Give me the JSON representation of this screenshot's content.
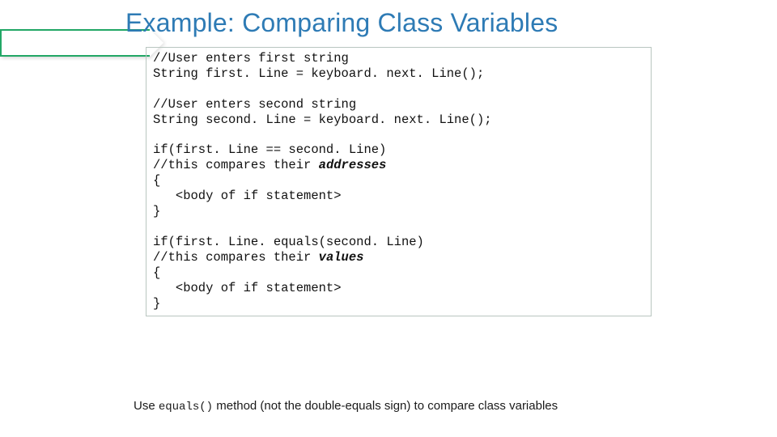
{
  "title": "Example: Comparing Class Variables",
  "code": {
    "l1": "//User enters first string",
    "l2": "String first. Line = keyboard. next. Line();",
    "blank1": "",
    "l3": "//User enters second string",
    "l4": "String second. Line = keyboard. next. Line();",
    "blank2": "",
    "l5": "if(first. Line == second. Line)",
    "l6a": "//this compares their ",
    "l6b": "addresses",
    "l7": "{",
    "l8": "   <body of if statement>",
    "l9": "}",
    "blank3": "",
    "l10": "if(first. Line. equals(second. Line)",
    "l11a": "//this compares their ",
    "l11b": "values",
    "l12": "{",
    "l13": "   <body of if statement>",
    "l14": "}"
  },
  "caption": {
    "pre": "Use ",
    "mono": "equals()",
    "post": " method (not the double-equals sign) to compare class variables"
  }
}
